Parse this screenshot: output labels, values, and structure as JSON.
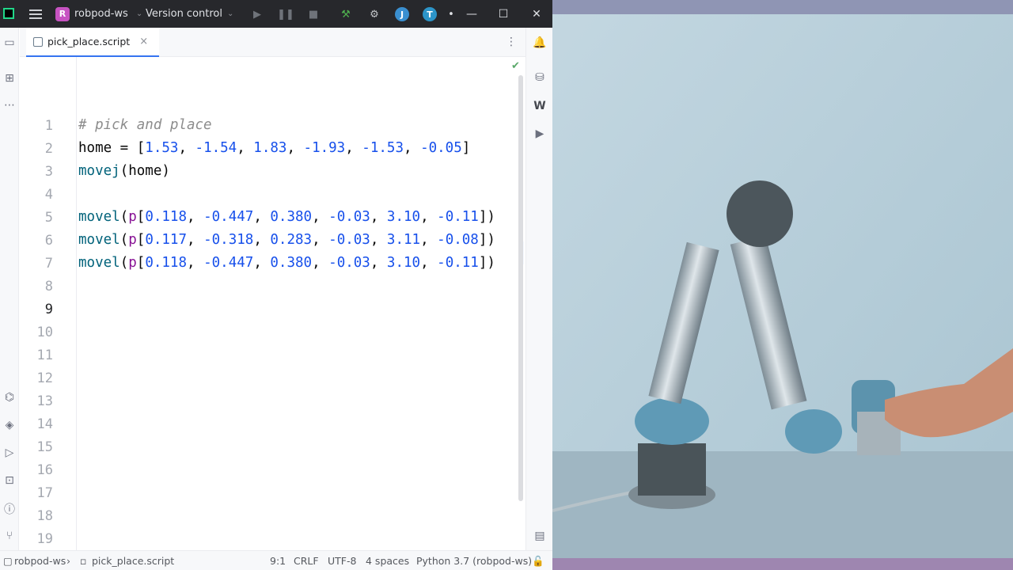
{
  "titlebar": {
    "project_badge": "R",
    "project_name": "robpod-ws",
    "version_control": "Version control",
    "avatars": [
      "J",
      "T"
    ]
  },
  "editor": {
    "tab_label": "pick_place.script",
    "lines": [
      {
        "number": "1",
        "text": "# pick and place"
      },
      {
        "number": "2",
        "text": "home = [1.53, -1.54, 1.83, -1.93, -1.53, -0.05]"
      },
      {
        "number": "3",
        "text": "movej(home)"
      },
      {
        "number": "4",
        "text": ""
      },
      {
        "number": "5",
        "text": "movel(p[0.118, -0.447, 0.380, -0.03, 3.10, -0.11])"
      },
      {
        "number": "6",
        "text": "movel(p[0.117, -0.318, 0.283, -0.03, 3.11, -0.08])"
      },
      {
        "number": "7",
        "text": "movel(p[0.118, -0.447, 0.380, -0.03, 3.10, -0.11])"
      },
      {
        "number": "8",
        "text": ""
      },
      {
        "number": "9",
        "text": ""
      },
      {
        "number": "10",
        "text": ""
      },
      {
        "number": "11",
        "text": ""
      },
      {
        "number": "12",
        "text": ""
      },
      {
        "number": "13",
        "text": ""
      },
      {
        "number": "14",
        "text": ""
      },
      {
        "number": "15",
        "text": ""
      },
      {
        "number": "16",
        "text": ""
      },
      {
        "number": "17",
        "text": ""
      },
      {
        "number": "18",
        "text": ""
      },
      {
        "number": "19",
        "text": ""
      }
    ],
    "current_line": "9"
  },
  "rightbar": {
    "w_label": "W"
  },
  "statusbar": {
    "breadcrumb_project": "robpod-ws",
    "breadcrumb_file": "pick_place.script",
    "caret": "9:1",
    "line_ending": "CRLF",
    "encoding": "UTF-8",
    "indent": "4 spaces",
    "interpreter": "Python 3.7 (robpod-ws)"
  },
  "colors": {
    "accent": "#3574f0",
    "number": "#1750eb",
    "function": "#00627a",
    "comment": "#8c8c8c",
    "prefix": "#871094"
  },
  "icons": [
    "folder-icon",
    "structure-icon",
    "more-icon",
    "python-icon",
    "layers-icon",
    "run-icon",
    "terminal-icon",
    "problems-icon",
    "git-icon",
    "notifications-icon",
    "database-icon",
    "document-icon",
    "play-icon",
    "pause-icon",
    "stop-icon",
    "build-icon",
    "settings-icon"
  ]
}
